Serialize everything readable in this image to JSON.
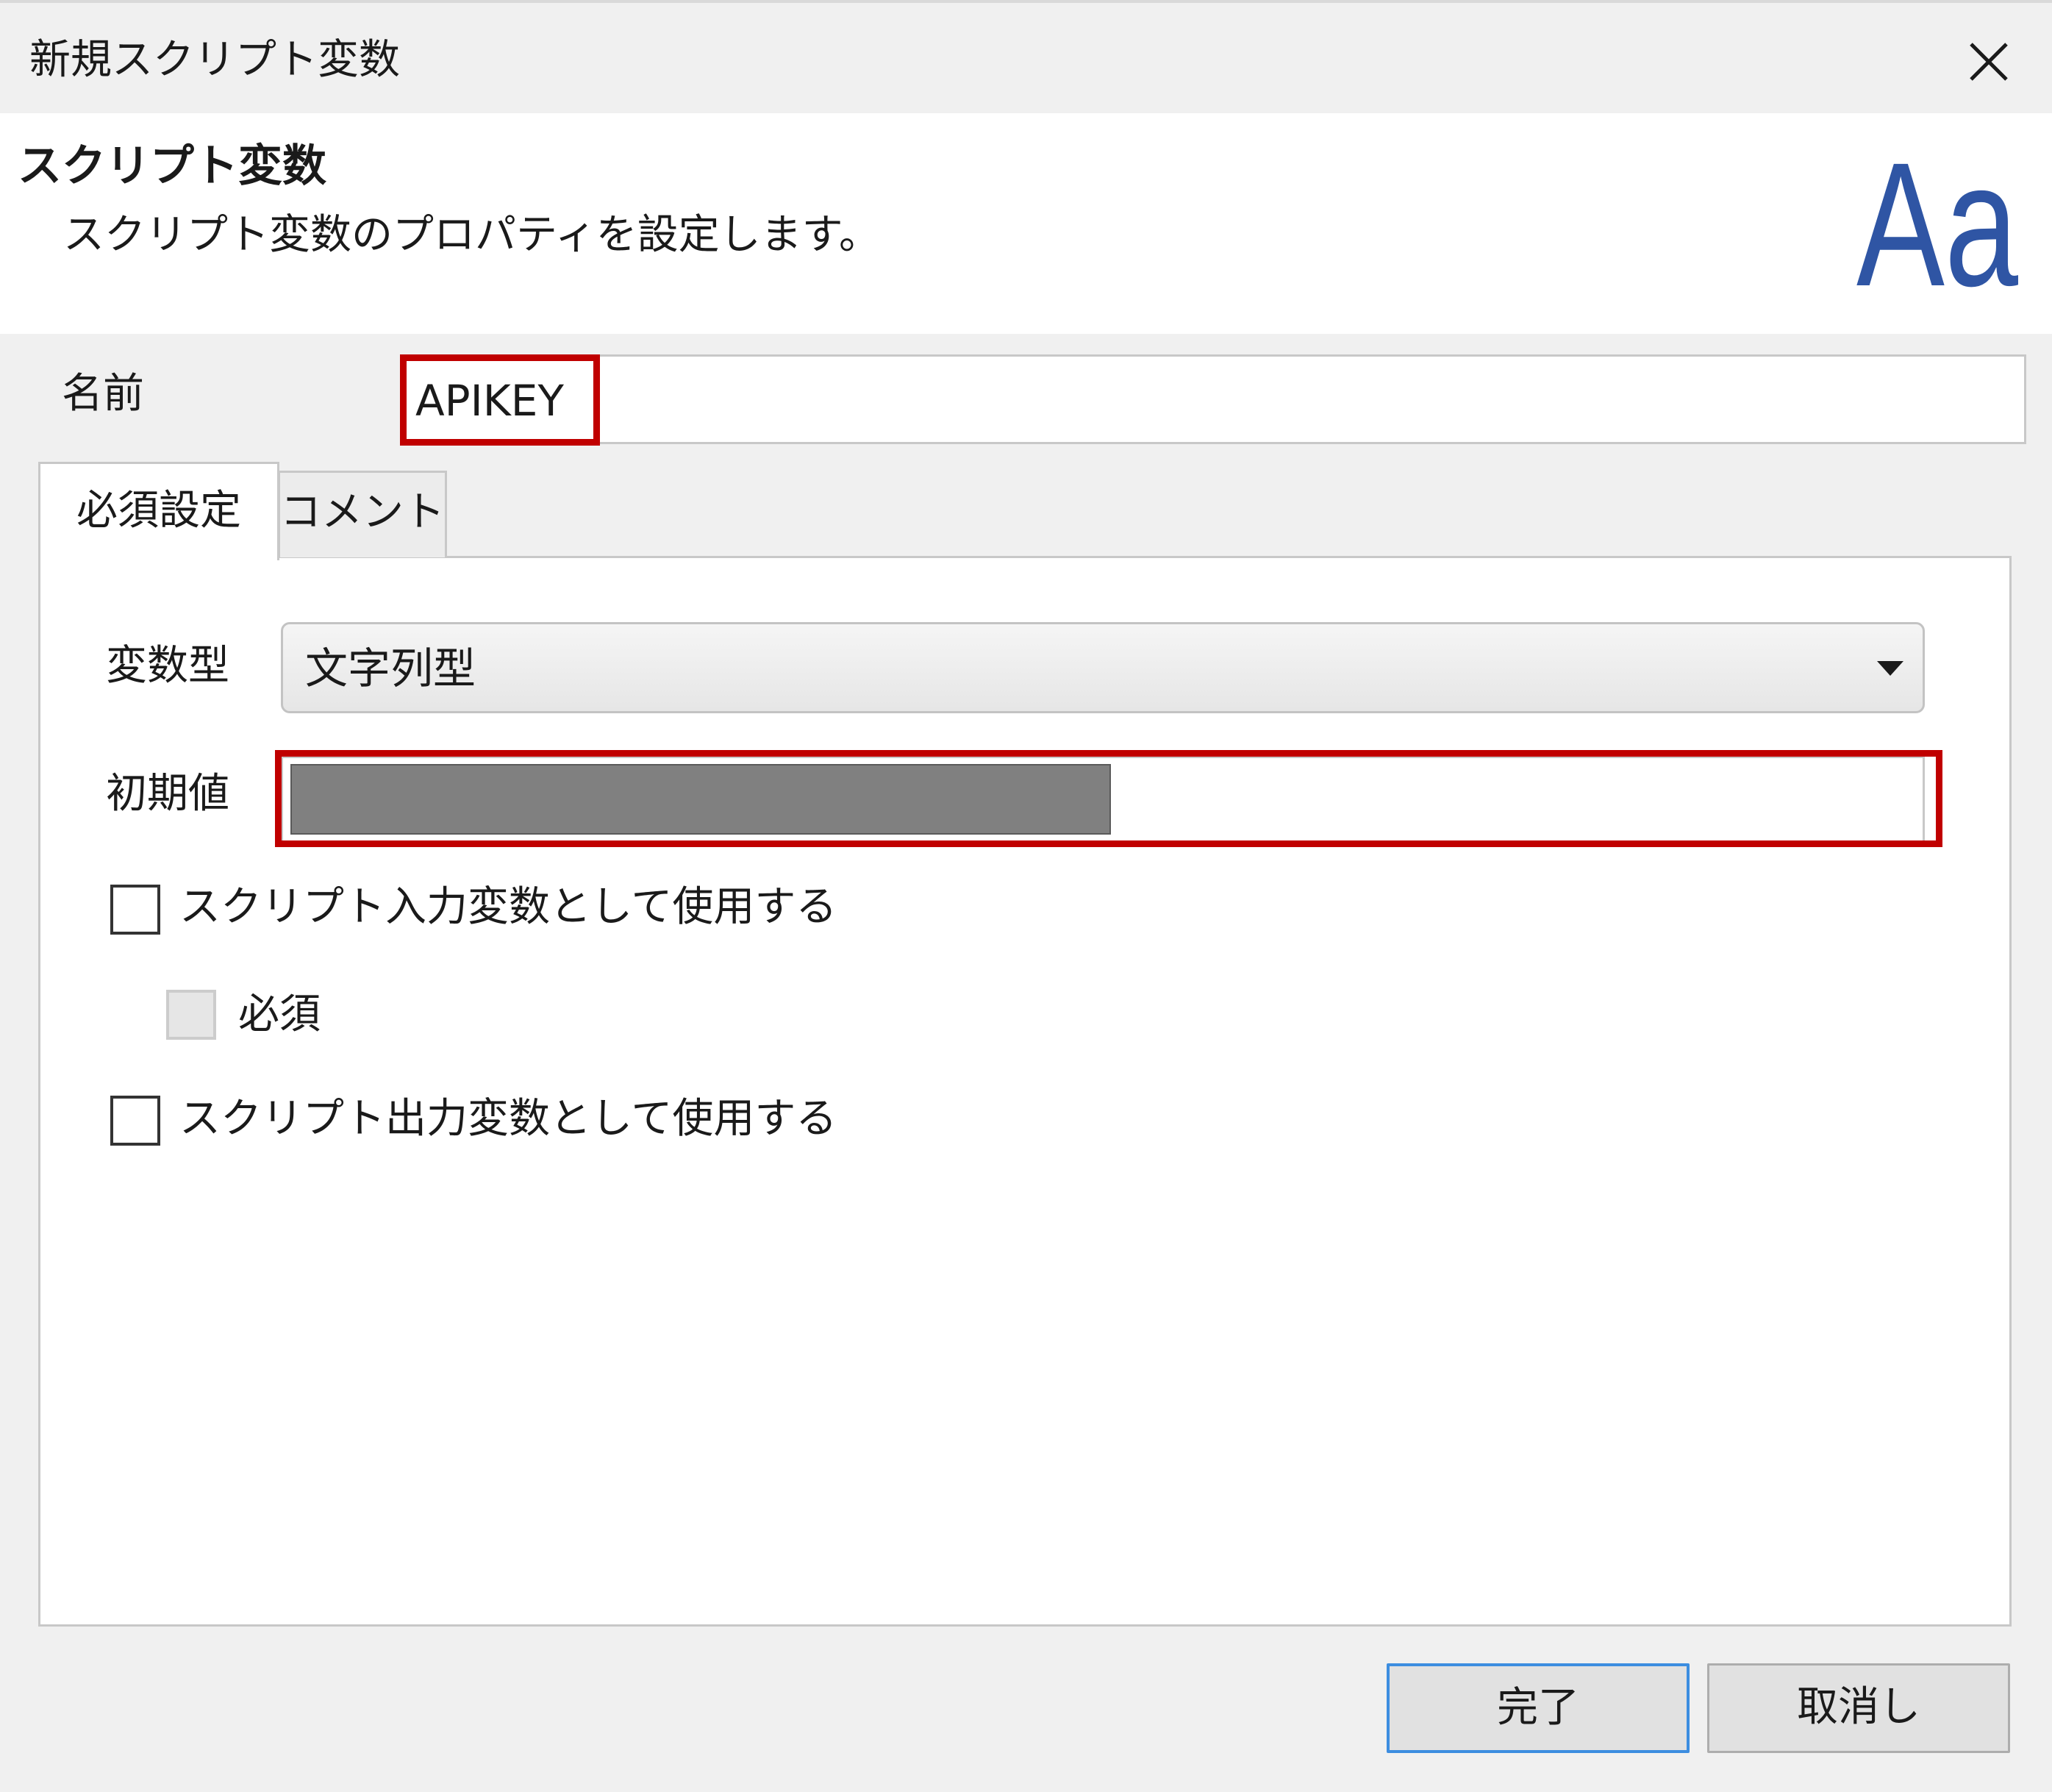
{
  "window": {
    "title": "新規スクリプト変数"
  },
  "header": {
    "title": "スクリプト変数",
    "description": "スクリプト変数のプロパティを設定します。",
    "icon_text": "Aa",
    "icon_color": "#2f55a4"
  },
  "name_field": {
    "label": "名前",
    "value": "APIKEY"
  },
  "tabs": [
    {
      "label": "必須設定",
      "active": true
    },
    {
      "label": "コメント",
      "active": false
    }
  ],
  "form": {
    "type_label": "変数型",
    "type_value": "文字列型",
    "initial_label": "初期値",
    "initial_value_redacted": true,
    "use_as_input_label": "スクリプト入力変数として使用する",
    "use_as_input_checked": false,
    "required_label": "必須",
    "required_checked": false,
    "required_enabled": false,
    "use_as_output_label": "スクリプト出力変数として使用する",
    "use_as_output_checked": false
  },
  "buttons": {
    "ok_label": "完了",
    "cancel_label": "取消し"
  },
  "colors": {
    "highlight": "#c00000",
    "redaction": "#808080",
    "focus_border": "#3c8de0"
  }
}
